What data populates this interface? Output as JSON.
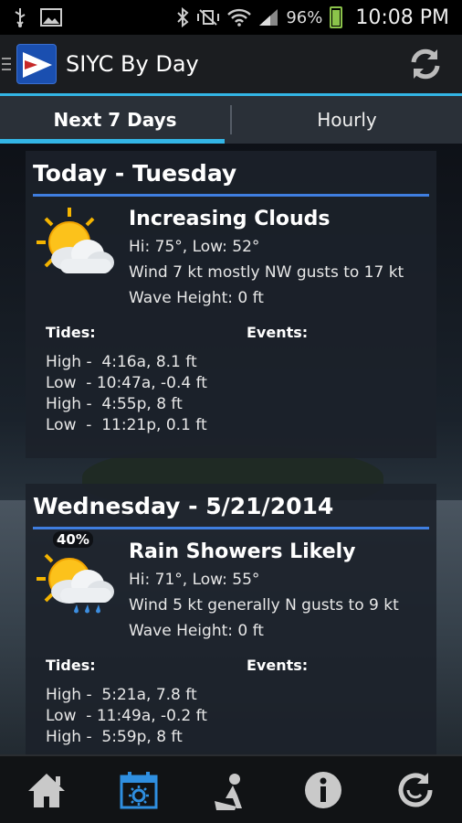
{
  "status": {
    "battery": "96%",
    "time": "10:08 PM"
  },
  "app": {
    "title": "SIYC By Day"
  },
  "tabs": [
    {
      "label": "Next 7 Days",
      "active": true
    },
    {
      "label": "Hourly",
      "active": false
    }
  ],
  "days": [
    {
      "heading": "Today - Tuesday",
      "condition": "Increasing Clouds",
      "temps": "Hi: 75°, Low: 52°",
      "wind": "Wind 7 kt  mostly NW gusts to 17 kt",
      "waves": "Wave Height: 0 ft",
      "icon": "partly-cloudy-sun-icon",
      "tides_label": "Tides:",
      "events_label": "Events:",
      "tides": [
        "High -  4:16a, 8.1 ft",
        "Low  - 10:47a, -0.4 ft",
        "High -  4:55p, 8 ft",
        "Low  -  11:21p, 0.1 ft"
      ]
    },
    {
      "heading": "Wednesday - 5/21/2014",
      "condition": "Rain Showers Likely",
      "temps": "Hi: 71°, Low: 55°",
      "wind": "Wind 5 kt  generally N gusts to 9 kt",
      "waves": "Wave Height: 0 ft",
      "icon": "rain-showers-sun-icon",
      "precip": "40%",
      "tides_label": "Tides:",
      "events_label": "Events:",
      "tides": [
        "High -  5:21a, 7.8 ft",
        "Low  - 11:49a, -0.2 ft",
        "High -  5:59p, 8 ft"
      ]
    }
  ],
  "nav": [
    {
      "name": "home-icon"
    },
    {
      "name": "calendar-sun-icon",
      "active": true
    },
    {
      "name": "sailor-icon"
    },
    {
      "name": "info-icon"
    },
    {
      "name": "reload-icon"
    }
  ],
  "colors": {
    "accent": "#33b5e5",
    "card_rule": "#3f7ee0",
    "nav_active": "#2f8fe0"
  }
}
